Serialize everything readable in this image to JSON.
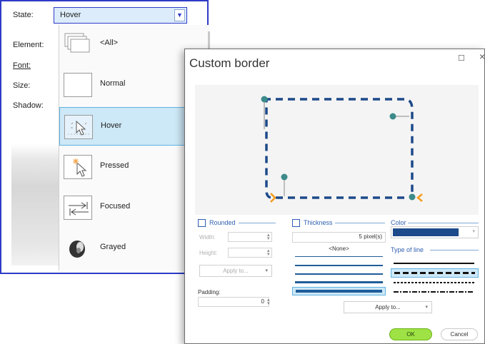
{
  "style_editor": {
    "labels": {
      "state": "State:",
      "element": "Element:",
      "font": "Font:",
      "size": "Size:",
      "shadow": "Shadow:"
    },
    "state_value": "Hover",
    "state_options": [
      {
        "label": "<All>",
        "icon": "all-states-icon"
      },
      {
        "label": "Normal",
        "icon": "normal-state-icon"
      },
      {
        "label": "Hover",
        "icon": "hover-state-icon"
      },
      {
        "label": "Pressed",
        "icon": "pressed-state-icon"
      },
      {
        "label": "Focused",
        "icon": "focused-state-icon"
      },
      {
        "label": "Grayed",
        "icon": "grayed-state-icon"
      }
    ],
    "selected_option": "Hover"
  },
  "custom_border": {
    "title": "Custom border",
    "rounded": {
      "label": "Rounded",
      "checked": false,
      "width_label": "Width:",
      "height_label": "Height:",
      "apply_label": "Apply to..."
    },
    "padding": {
      "label": "Padding:",
      "value": "0"
    },
    "thickness": {
      "label": "Thickness",
      "checked": false,
      "value": "5 pixel(s)",
      "none_label": "<None>",
      "apply_label": "Apply to..."
    },
    "color": {
      "label": "Color",
      "value": "#1c4a8a"
    },
    "line_type": {
      "label": "Type of line",
      "options": [
        "solid",
        "dashed",
        "dotted",
        "dash-dot"
      ],
      "selected": "dashed"
    },
    "ok_label": "OK",
    "cancel_label": "Cancel"
  },
  "colors": {
    "accent_blue": "#2d3bc7",
    "selection": "#cde8f7",
    "border_line": "#1c4a8a",
    "handle": "#3d8a8a",
    "ok_green": "#9ee245",
    "corner_orange": "#f39c1c"
  }
}
